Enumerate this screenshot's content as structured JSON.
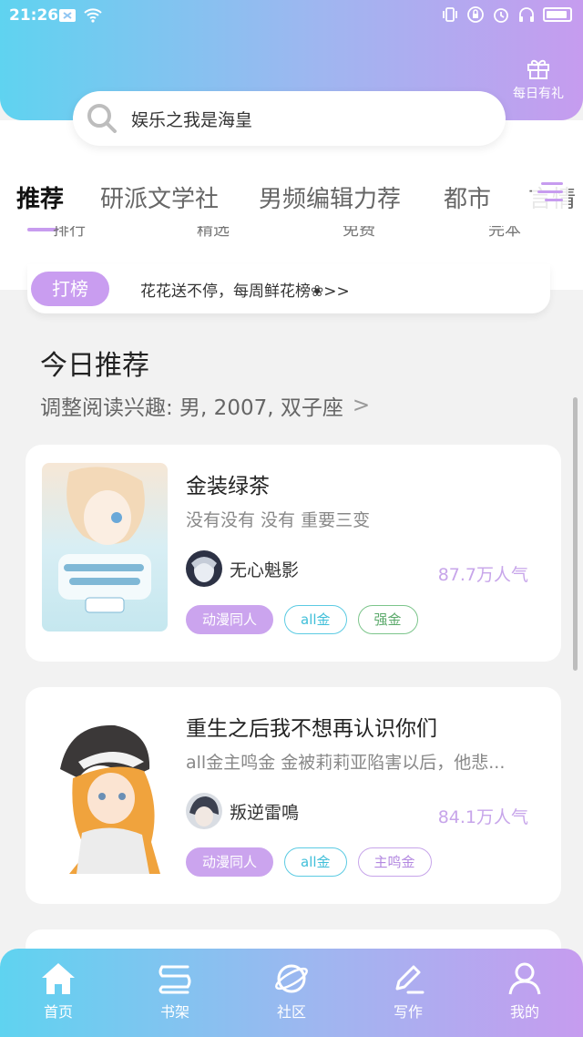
{
  "status_bar": {
    "time": "21:26",
    "left_icons": [
      "notification-x-icon",
      "wifi-icon"
    ],
    "right_icons": [
      "vibrate-icon",
      "lock-icon",
      "alarm-icon",
      "headset-icon",
      "battery-icon"
    ]
  },
  "header": {
    "gift_label": "每日有礼",
    "search_text": "娱乐之我是海皇"
  },
  "tabs": {
    "items": [
      "推荐",
      "研派文学社",
      "男频编辑力荐",
      "都市",
      "言情"
    ],
    "active_index": 0
  },
  "sub_nav_partial": [
    "排行",
    "精选",
    "免费",
    "完本"
  ],
  "banner": {
    "tag": "打榜",
    "text": "花花送不停，每周鲜花榜❀>>"
  },
  "section": {
    "title": "今日推荐",
    "subtitle": "调整阅读兴趣: 男, 2007, 双子座",
    "chevron": ">"
  },
  "books": [
    {
      "title": "金装绿茶",
      "description": "没有没有  没有  重要三变",
      "author": "无心魁影",
      "popularity": "87.7万人气",
      "tags": [
        {
          "label": "动漫同人",
          "style": "fill"
        },
        {
          "label": "all金",
          "style": "cyan"
        },
        {
          "label": "强金",
          "style": "green"
        }
      ]
    },
    {
      "title": "重生之后我不想再认识你们",
      "description": "all金主鸣金     金被莉莉亚陷害以后，他悲...",
      "author": "叛逆雷鳴",
      "popularity": "84.1万人气",
      "tags": [
        {
          "label": "动漫同人",
          "style": "fill"
        },
        {
          "label": "all金",
          "style": "cyan"
        },
        {
          "label": "主鸣金",
          "style": "purple"
        }
      ]
    }
  ],
  "bottom_nav": [
    {
      "label": "首页",
      "icon": "home-icon"
    },
    {
      "label": "书架",
      "icon": "bookshelf-icon"
    },
    {
      "label": "社区",
      "icon": "planet-icon"
    },
    {
      "label": "写作",
      "icon": "pen-icon"
    },
    {
      "label": "我的",
      "icon": "user-icon"
    }
  ],
  "colors": {
    "gradient_start": "#5fd3f0",
    "gradient_end": "#c69cef",
    "accent_purple": "#c99df0"
  }
}
